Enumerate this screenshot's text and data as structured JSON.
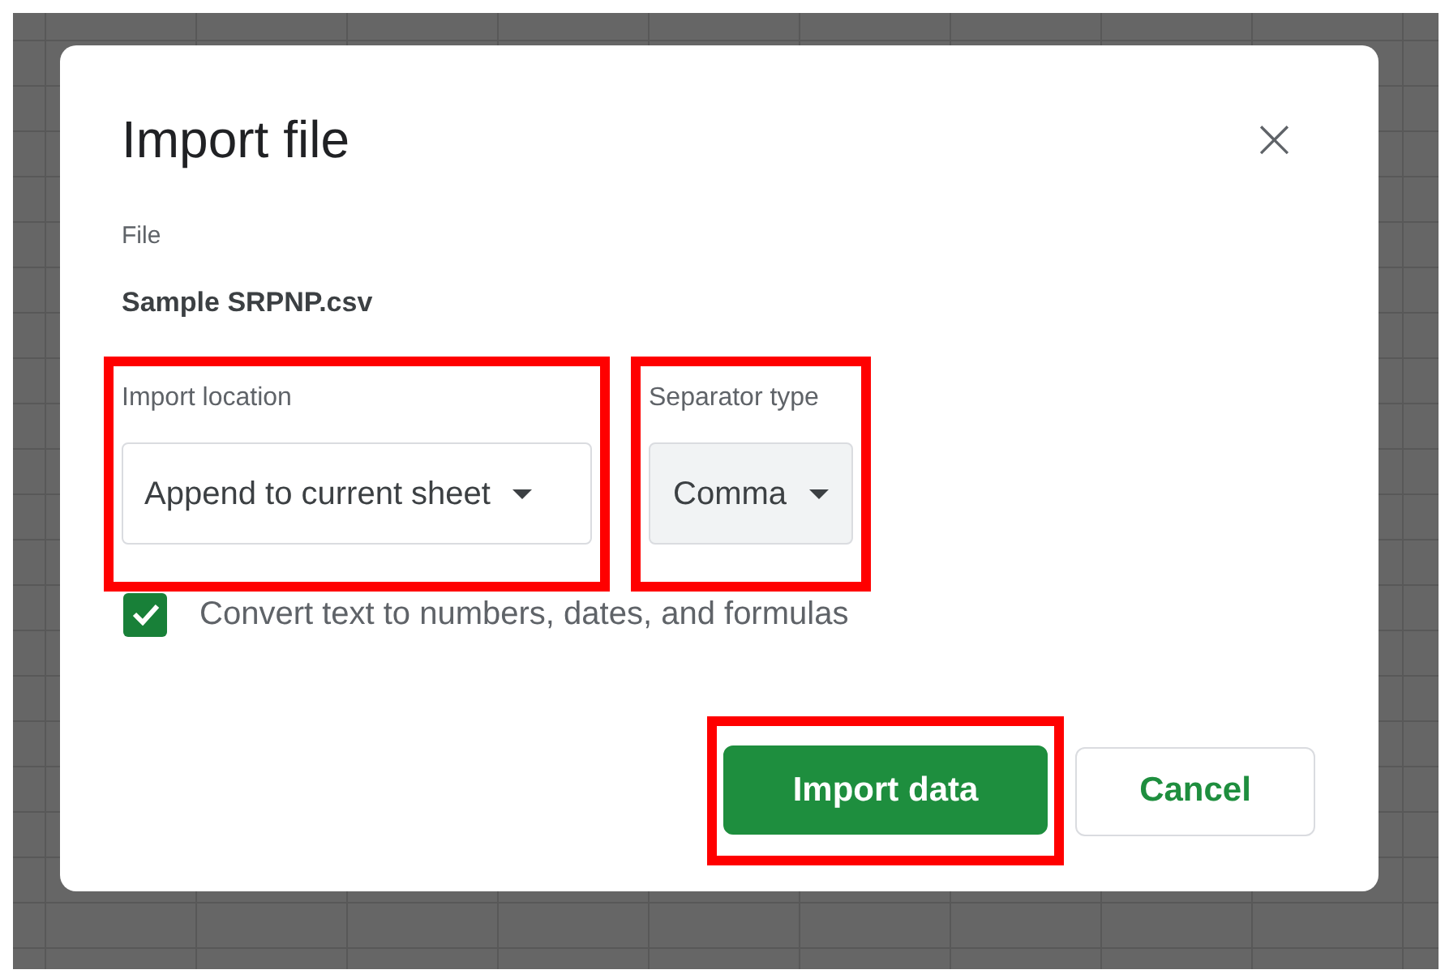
{
  "dialog": {
    "title": "Import file",
    "close": "×"
  },
  "file": {
    "label": "File",
    "name": "Sample SRPNP.csv"
  },
  "fields": [
    {
      "label": "Import location",
      "value": "Append to current sheet",
      "highlighted": true,
      "kind": "outlined"
    },
    {
      "label": "Separator type",
      "value": "Comma",
      "highlighted": true,
      "kind": "filled"
    }
  ],
  "convert_option": {
    "label": "Convert text to numbers, dates, and formulas",
    "checked": true
  },
  "buttons": [
    {
      "label": "Import data",
      "kind": "primary",
      "highlighted": true
    },
    {
      "label": "Cancel",
      "kind": "secondary",
      "highlighted": false
    }
  ]
}
